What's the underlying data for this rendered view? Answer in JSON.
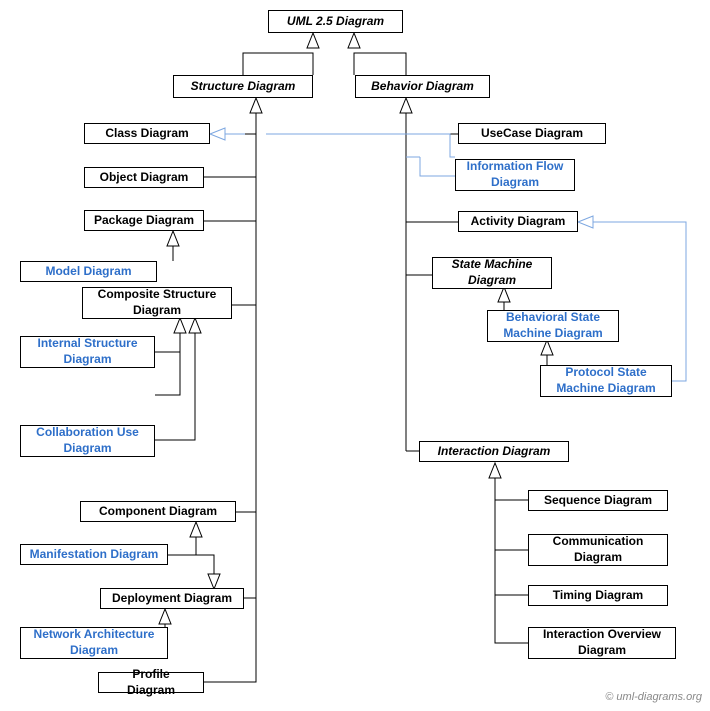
{
  "root": "UML 2.5 Diagram",
  "structure": "Structure Diagram",
  "behavior": "Behavior Diagram",
  "class_d": "Class Diagram",
  "object_d": "Object Diagram",
  "package_d": "Package Diagram",
  "model_d": "Model Diagram",
  "composite_d": "Composite Structure Diagram",
  "internal_str_d": "Internal Structure Diagram",
  "collab_use_d": "Collaboration Use Diagram",
  "component_d": "Component Diagram",
  "manifest_d": "Manifestation Diagram",
  "deployment_d": "Deployment Diagram",
  "netarch_d": "Network Architecture Diagram",
  "profile_d": "Profile Diagram",
  "usecase_d": "UseCase Diagram",
  "infoflow_d": "Information Flow Diagram",
  "activity_d": "Activity Diagram",
  "statemachine_d": "State Machine Diagram",
  "beh_sm_d": "Behavioral State Machine Diagram",
  "proto_sm_d": "Protocol State Machine Diagram",
  "interaction_d": "Interaction Diagram",
  "sequence_d": "Sequence Diagram",
  "communication_d": "Communication Diagram",
  "timing_d": "Timing Diagram",
  "int_overview_d": "Interaction Overview Diagram",
  "copyright": "© uml-diagrams.org"
}
